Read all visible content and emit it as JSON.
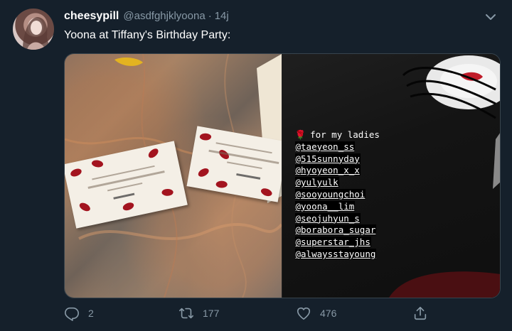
{
  "tweet": {
    "display_name": "cheesypill",
    "handle": "@asdfghjklyoona",
    "separator": "·",
    "time": "14j",
    "text": "Yoona at Tiffany's Birthday Party:",
    "story": {
      "heading": "for my ladies",
      "rose_icon": "🌹",
      "mentions": [
        "@taeyeon_ss",
        "@515sunnyday",
        "@hyoyeon_x_x",
        "@yulyulk",
        "@sooyoungchoi",
        "@yoona__lim",
        "@seojuhyun_s",
        "@borabora_sugar",
        "@superstar_jhs",
        "@alwaysstayoung"
      ]
    },
    "actions": {
      "reply_count": "2",
      "retweet_count": "177",
      "like_count": "476"
    }
  },
  "icons": {
    "reply": "reply-icon",
    "retweet": "retweet-icon",
    "like": "heart-icon",
    "share": "share-icon",
    "more": "chevron-down-icon"
  },
  "colors": {
    "background": "#15202b",
    "secondary_text": "#8899a6",
    "text": "#ffffff"
  }
}
